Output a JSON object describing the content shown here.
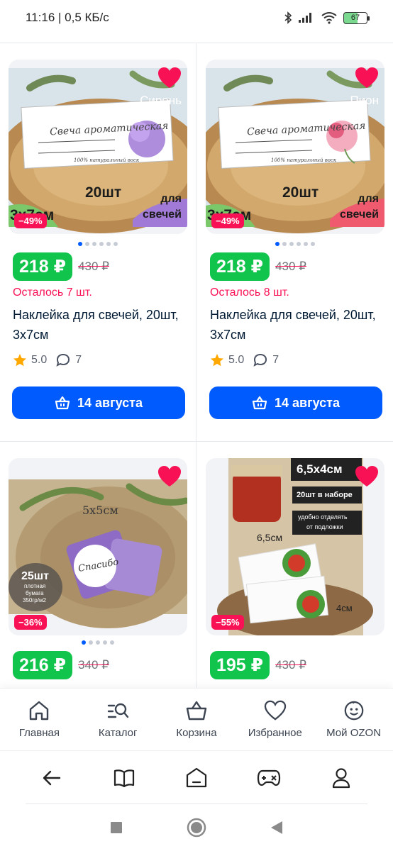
{
  "status_bar": {
    "time": "11:16 | 0,5 КБ/с",
    "battery": "67"
  },
  "products": [
    {
      "label_script": "Свеча ароматическая",
      "label_small": "100% натуральный воск",
      "variant": "Сирень",
      "count_text": "20шт",
      "size_text": "3х7см",
      "for_text_1": "для",
      "for_text_2": "свечей",
      "discount": "−49%",
      "price": "218 ₽",
      "old_price": "430 ₽",
      "stock": "Осталось 7 шт.",
      "title": "Наклейка для свечей, 20шт, 3х7см",
      "rating": "5.0",
      "reviews": "7",
      "delivery": "14 августа",
      "accent": "#a07ad6"
    },
    {
      "label_script": "Свеча ароматическая",
      "label_small": "100% натуральный воск",
      "variant": "Пион",
      "count_text": "20шт",
      "size_text": "3х7см",
      "for_text_1": "для",
      "for_text_2": "свечей",
      "discount": "−49%",
      "price": "218 ₽",
      "old_price": "430 ₽",
      "stock": "Осталось 8 шт.",
      "title": "Наклейка для свечей, 20шт, 3х7см",
      "rating": "5.0",
      "reviews": "7",
      "delivery": "14 августа",
      "accent": "#e35d7f"
    },
    {
      "size_text": "5х5см",
      "count_text": "25шт",
      "count_sub_1": "плотная",
      "count_sub_2": "бумага",
      "count_sub_3": "350гр/м2",
      "sticker_text": "Спасибо",
      "discount": "−36%",
      "price": "216 ₽",
      "old_price": "340 ₽"
    },
    {
      "size_text": "6,5х4см",
      "count_text": "20шт в наборе",
      "note_1": "удобно отделять",
      "note_2": "от подложки",
      "dim_w": "6,5см",
      "dim_h": "4см",
      "discount": "−55%",
      "price": "195 ₽",
      "old_price": "430 ₽"
    }
  ],
  "tabbar": [
    {
      "label": "Главная",
      "icon": "home-icon"
    },
    {
      "label": "Каталог",
      "icon": "catalog-search-icon"
    },
    {
      "label": "Корзина",
      "icon": "basket-icon"
    },
    {
      "label": "Избранное",
      "icon": "heart-icon"
    },
    {
      "label": "Мой OZON",
      "icon": "profile-smile-icon"
    }
  ],
  "browser_bar": [
    "back-arrow-icon",
    "book-icon",
    "home-tab-icon",
    "gamepad-icon",
    "user-icon"
  ],
  "system_nav": [
    "recents-square-icon",
    "home-circle-icon",
    "back-triangle-icon"
  ],
  "colors": {
    "brand_blue": "#005bff",
    "price_green": "#10c44c",
    "discount_red": "#f91155"
  }
}
